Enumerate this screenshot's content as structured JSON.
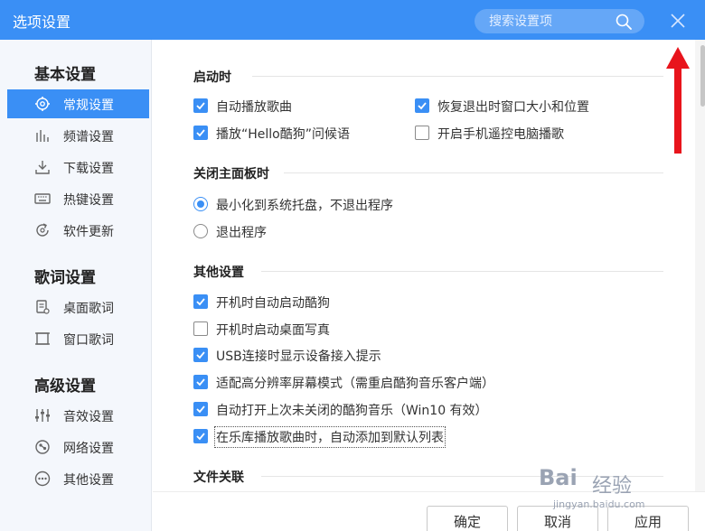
{
  "window": {
    "title": "选项设置"
  },
  "search": {
    "placeholder": "搜索设置项"
  },
  "sidebar": {
    "groups": [
      {
        "title": "基本设置"
      },
      {
        "title": "歌词设置"
      },
      {
        "title": "高级设置"
      }
    ],
    "items": [
      {
        "label": "常规设置",
        "icon": "gear-icon",
        "active": true
      },
      {
        "label": "频谱设置",
        "icon": "spectrum-icon"
      },
      {
        "label": "下载设置",
        "icon": "download-icon"
      },
      {
        "label": "热键设置",
        "icon": "keyboard-icon"
      },
      {
        "label": "软件更新",
        "icon": "update-icon"
      },
      {
        "label": "桌面歌词",
        "icon": "desktop-lyrics-icon"
      },
      {
        "label": "窗口歌词",
        "icon": "window-lyrics-icon"
      },
      {
        "label": "音效设置",
        "icon": "equalizer-icon"
      },
      {
        "label": "网络设置",
        "icon": "network-icon"
      },
      {
        "label": "其他设置",
        "icon": "more-icon"
      }
    ]
  },
  "sections": {
    "startup": {
      "title": "启动时",
      "options": [
        {
          "label": "自动播放歌曲",
          "checked": true
        },
        {
          "label": "恢复退出时窗口大小和位置",
          "checked": true
        },
        {
          "label": "播放“Hello酷狗”问候语",
          "checked": true
        },
        {
          "label": "开启手机遥控电脑播歌",
          "checked": false
        }
      ]
    },
    "close": {
      "title": "关闭主面板时",
      "options": [
        {
          "label": "最小化到系统托盘，不退出程序",
          "selected": true
        },
        {
          "label": "退出程序",
          "selected": false
        }
      ]
    },
    "other": {
      "title": "其他设置",
      "options": [
        {
          "label": "开机时自动启动酷狗",
          "checked": true
        },
        {
          "label": "开机时启动桌面写真",
          "checked": false
        },
        {
          "label": "USB连接时显示设备接入提示",
          "checked": true
        },
        {
          "label": "适配高分辨率屏幕模式（需重启酷狗音乐客户端）",
          "checked": true
        },
        {
          "label": "自动打开上次未关闭的酷狗音乐（Win10 有效）",
          "checked": true
        },
        {
          "label": "在乐库播放歌曲时，自动添加到默认列表",
          "checked": true
        }
      ]
    },
    "file": {
      "title": "文件关联"
    }
  },
  "footer": {
    "confirm_label": "确定",
    "cancel_label": "取消",
    "apply_label": "应用"
  },
  "watermark": {
    "logo": "Bai",
    "text": "经验",
    "sub": "jingyan.baidu.com"
  },
  "colors": {
    "accent": "#3a8ff5",
    "arrow": "#e8141c",
    "sidebar_bg": "#f4f7fc"
  }
}
